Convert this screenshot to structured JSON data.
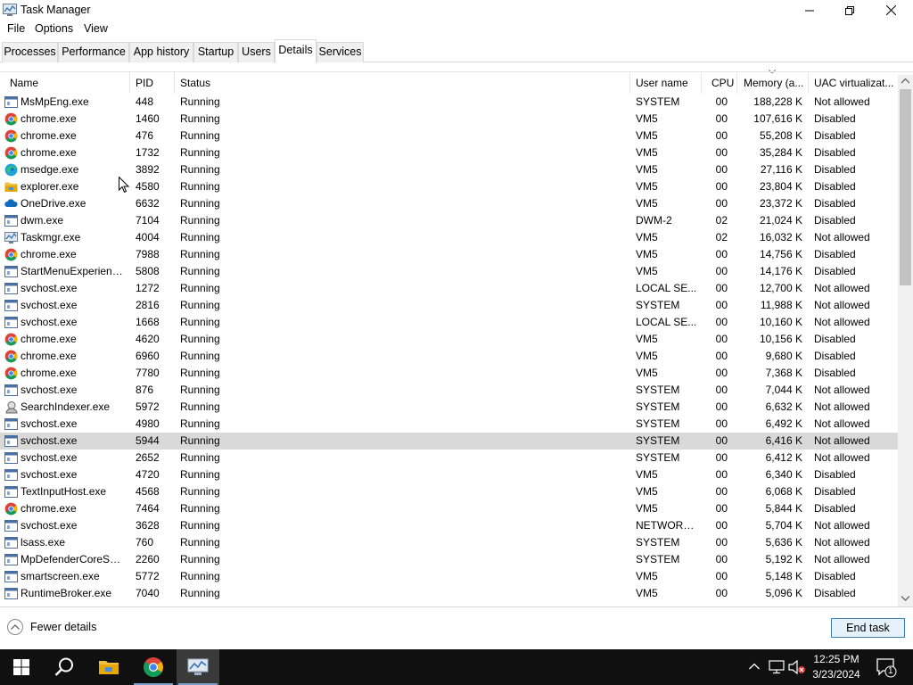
{
  "window": {
    "title": "Task Manager"
  },
  "menu": [
    "File",
    "Options",
    "View"
  ],
  "tabs": [
    "Processes",
    "Performance",
    "App history",
    "Startup",
    "Users",
    "Details",
    "Services"
  ],
  "active_tab": "Details",
  "columns": {
    "name": "Name",
    "pid": "PID",
    "status": "Status",
    "user": "User name",
    "cpu": "CPU",
    "memory": "Memory (a...",
    "uac": "UAC virtualizat..."
  },
  "rows": [
    {
      "name": "MsMpEng.exe",
      "pid": "448",
      "status": "Running",
      "user": "SYSTEM",
      "cpu": "00",
      "memory": "188,228 K",
      "uac": "Not allowed",
      "icon": "app-icon"
    },
    {
      "name": "chrome.exe",
      "pid": "1460",
      "status": "Running",
      "user": "VM5",
      "cpu": "00",
      "memory": "107,616 K",
      "uac": "Disabled",
      "icon": "chrome-icon"
    },
    {
      "name": "chrome.exe",
      "pid": "476",
      "status": "Running",
      "user": "VM5",
      "cpu": "00",
      "memory": "55,208 K",
      "uac": "Disabled",
      "icon": "chrome-icon"
    },
    {
      "name": "chrome.exe",
      "pid": "1732",
      "status": "Running",
      "user": "VM5",
      "cpu": "00",
      "memory": "35,284 K",
      "uac": "Disabled",
      "icon": "chrome-icon"
    },
    {
      "name": "msedge.exe",
      "pid": "3892",
      "status": "Running",
      "user": "VM5",
      "cpu": "00",
      "memory": "27,116 K",
      "uac": "Disabled",
      "icon": "edge-icon"
    },
    {
      "name": "explorer.exe",
      "pid": "4580",
      "status": "Running",
      "user": "VM5",
      "cpu": "00",
      "memory": "23,804 K",
      "uac": "Disabled",
      "icon": "folder-icon"
    },
    {
      "name": "OneDrive.exe",
      "pid": "6632",
      "status": "Running",
      "user": "VM5",
      "cpu": "00",
      "memory": "23,372 K",
      "uac": "Disabled",
      "icon": "cloud-icon"
    },
    {
      "name": "dwm.exe",
      "pid": "7104",
      "status": "Running",
      "user": "DWM-2",
      "cpu": "02",
      "memory": "21,024 K",
      "uac": "Disabled",
      "icon": "app-icon"
    },
    {
      "name": "Taskmgr.exe",
      "pid": "4004",
      "status": "Running",
      "user": "VM5",
      "cpu": "02",
      "memory": "16,032 K",
      "uac": "Not allowed",
      "icon": "taskmgr-icon"
    },
    {
      "name": "chrome.exe",
      "pid": "7988",
      "status": "Running",
      "user": "VM5",
      "cpu": "00",
      "memory": "14,756 K",
      "uac": "Disabled",
      "icon": "chrome-icon"
    },
    {
      "name": "StartMenuExperienc...",
      "pid": "5808",
      "status": "Running",
      "user": "VM5",
      "cpu": "00",
      "memory": "14,176 K",
      "uac": "Disabled",
      "icon": "app-icon"
    },
    {
      "name": "svchost.exe",
      "pid": "1272",
      "status": "Running",
      "user": "LOCAL SE...",
      "cpu": "00",
      "memory": "12,700 K",
      "uac": "Not allowed",
      "icon": "app-icon"
    },
    {
      "name": "svchost.exe",
      "pid": "2816",
      "status": "Running",
      "user": "SYSTEM",
      "cpu": "00",
      "memory": "11,988 K",
      "uac": "Not allowed",
      "icon": "app-icon"
    },
    {
      "name": "svchost.exe",
      "pid": "1668",
      "status": "Running",
      "user": "LOCAL SE...",
      "cpu": "00",
      "memory": "10,160 K",
      "uac": "Not allowed",
      "icon": "app-icon"
    },
    {
      "name": "chrome.exe",
      "pid": "4620",
      "status": "Running",
      "user": "VM5",
      "cpu": "00",
      "memory": "10,156 K",
      "uac": "Disabled",
      "icon": "chrome-icon"
    },
    {
      "name": "chrome.exe",
      "pid": "6960",
      "status": "Running",
      "user": "VM5",
      "cpu": "00",
      "memory": "9,680 K",
      "uac": "Disabled",
      "icon": "chrome-icon"
    },
    {
      "name": "chrome.exe",
      "pid": "7780",
      "status": "Running",
      "user": "VM5",
      "cpu": "00",
      "memory": "7,368 K",
      "uac": "Disabled",
      "icon": "chrome-icon"
    },
    {
      "name": "svchost.exe",
      "pid": "876",
      "status": "Running",
      "user": "SYSTEM",
      "cpu": "00",
      "memory": "7,044 K",
      "uac": "Not allowed",
      "icon": "app-icon"
    },
    {
      "name": "SearchIndexer.exe",
      "pid": "5972",
      "status": "Running",
      "user": "SYSTEM",
      "cpu": "00",
      "memory": "6,632 K",
      "uac": "Not allowed",
      "icon": "search-indexer-icon"
    },
    {
      "name": "svchost.exe",
      "pid": "4980",
      "status": "Running",
      "user": "SYSTEM",
      "cpu": "00",
      "memory": "6,492 K",
      "uac": "Not allowed",
      "icon": "app-icon"
    },
    {
      "name": "svchost.exe",
      "pid": "5944",
      "status": "Running",
      "user": "SYSTEM",
      "cpu": "00",
      "memory": "6,416 K",
      "uac": "Not allowed",
      "icon": "app-icon",
      "selected": true
    },
    {
      "name": "svchost.exe",
      "pid": "2652",
      "status": "Running",
      "user": "SYSTEM",
      "cpu": "00",
      "memory": "6,412 K",
      "uac": "Not allowed",
      "icon": "app-icon"
    },
    {
      "name": "svchost.exe",
      "pid": "4720",
      "status": "Running",
      "user": "VM5",
      "cpu": "00",
      "memory": "6,340 K",
      "uac": "Disabled",
      "icon": "app-icon"
    },
    {
      "name": "TextInputHost.exe",
      "pid": "4568",
      "status": "Running",
      "user": "VM5",
      "cpu": "00",
      "memory": "6,068 K",
      "uac": "Disabled",
      "icon": "app-icon"
    },
    {
      "name": "chrome.exe",
      "pid": "7464",
      "status": "Running",
      "user": "VM5",
      "cpu": "00",
      "memory": "5,844 K",
      "uac": "Disabled",
      "icon": "chrome-icon"
    },
    {
      "name": "svchost.exe",
      "pid": "3628",
      "status": "Running",
      "user": "NETWORK...",
      "cpu": "00",
      "memory": "5,704 K",
      "uac": "Not allowed",
      "icon": "app-icon"
    },
    {
      "name": "lsass.exe",
      "pid": "760",
      "status": "Running",
      "user": "SYSTEM",
      "cpu": "00",
      "memory": "5,636 K",
      "uac": "Not allowed",
      "icon": "app-icon"
    },
    {
      "name": "MpDefenderCoreSer...",
      "pid": "2260",
      "status": "Running",
      "user": "SYSTEM",
      "cpu": "00",
      "memory": "5,192 K",
      "uac": "Not allowed",
      "icon": "app-icon"
    },
    {
      "name": "smartscreen.exe",
      "pid": "5772",
      "status": "Running",
      "user": "VM5",
      "cpu": "00",
      "memory": "5,148 K",
      "uac": "Disabled",
      "icon": "app-icon"
    },
    {
      "name": "RuntimeBroker.exe",
      "pid": "7040",
      "status": "Running",
      "user": "VM5",
      "cpu": "00",
      "memory": "5,096 K",
      "uac": "Disabled",
      "icon": "app-icon"
    }
  ],
  "footer": {
    "fewer_details": "Fewer details",
    "end_task": "End task"
  },
  "taskbar": {
    "time": "12:25 PM",
    "date": "3/23/2024",
    "notification_count": "1"
  },
  "colors": {
    "selected_row": "#d9d9d9",
    "taskbar": "#101010",
    "button_border": "#3c7fb1"
  }
}
